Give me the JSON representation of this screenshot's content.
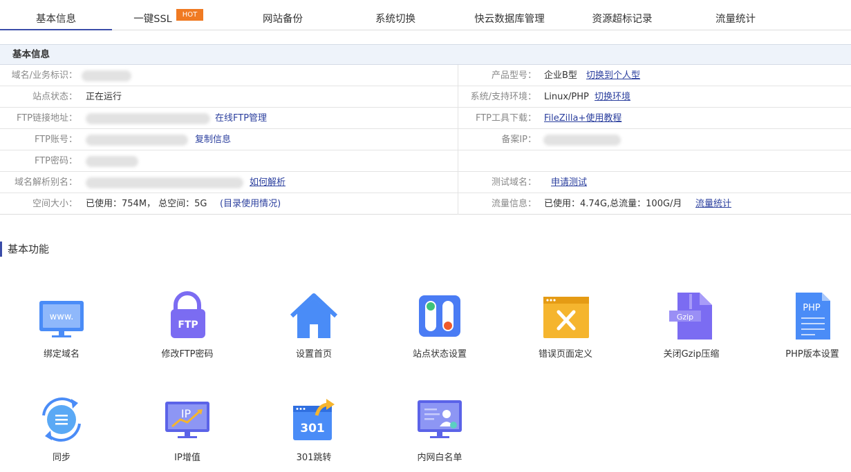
{
  "tabs": [
    {
      "label": "基本信息"
    },
    {
      "label": "一键SSL"
    },
    {
      "label": "网站备份"
    },
    {
      "label": "系统切换"
    },
    {
      "label": "快云数据库管理"
    },
    {
      "label": "资源超标记录"
    },
    {
      "label": "流量统计"
    }
  ],
  "hot_badge": "HOT",
  "info": {
    "title": "基本信息",
    "rows": [
      {
        "left_label": "域名/业务标识：",
        "right_label": "产品型号：",
        "right_value": "企业B型",
        "right_link": "切换到个人型"
      },
      {
        "left_label": "站点状态：",
        "left_value": "正在运行",
        "right_label": "系统/支持环境：",
        "right_value": "Linux/PHP",
        "right_link": "切换环境"
      },
      {
        "left_label": "FTP链接地址：",
        "left_link": "在线FTP管理",
        "right_label": "FTP工具下载：",
        "right_link": "FileZilla+使用教程"
      },
      {
        "left_label": "FTP账号：",
        "left_link": "复制信息",
        "right_label": "备案IP："
      },
      {
        "left_label": "FTP密码："
      },
      {
        "left_label": "域名解析别名：",
        "left_link": "如何解析",
        "right_label": "测试域名：",
        "right_link": "申请测试"
      },
      {
        "left_label": "空间大小：",
        "left_value": "已使用：754M，  总空间：5G",
        "left_link": "(目录使用情况)",
        "right_label": "流量信息：",
        "right_value": "已使用：4.74G,总流量：100G/月",
        "right_link": "流量统计"
      }
    ]
  },
  "functions": {
    "title": "基本功能",
    "items": [
      {
        "label": "绑定域名",
        "icon": "www-monitor-icon"
      },
      {
        "label": "修改FTP密码",
        "icon": "ftp-lock-icon"
      },
      {
        "label": "设置首页",
        "icon": "home-icon"
      },
      {
        "label": "站点状态设置",
        "icon": "status-toggle-icon"
      },
      {
        "label": "错误页面定义",
        "icon": "error-page-icon"
      },
      {
        "label": "关闭Gzip压缩",
        "icon": "gzip-file-icon"
      },
      {
        "label": "PHP版本设置",
        "icon": "php-file-icon"
      },
      {
        "label": "同步",
        "icon": "sync-icon"
      },
      {
        "label": "IP增值",
        "icon": "ip-chart-icon"
      },
      {
        "label": "301跳转",
        "icon": "redirect-301-icon"
      },
      {
        "label": "内网白名单",
        "icon": "whitelist-monitor-icon"
      }
    ]
  },
  "icon_text": {
    "www": "www.",
    "ftp": "FTP",
    "gzip": "Gzip",
    "php": "PHP",
    "ip": "IP",
    "r301": "301"
  },
  "colors": {
    "accent": "#3a4ca8",
    "link": "#2b3f9e",
    "hot": "#f07a22",
    "icon_blue": "#4a8cf7",
    "icon_purple": "#7b6cf2",
    "icon_yellow": "#f5b52e"
  }
}
